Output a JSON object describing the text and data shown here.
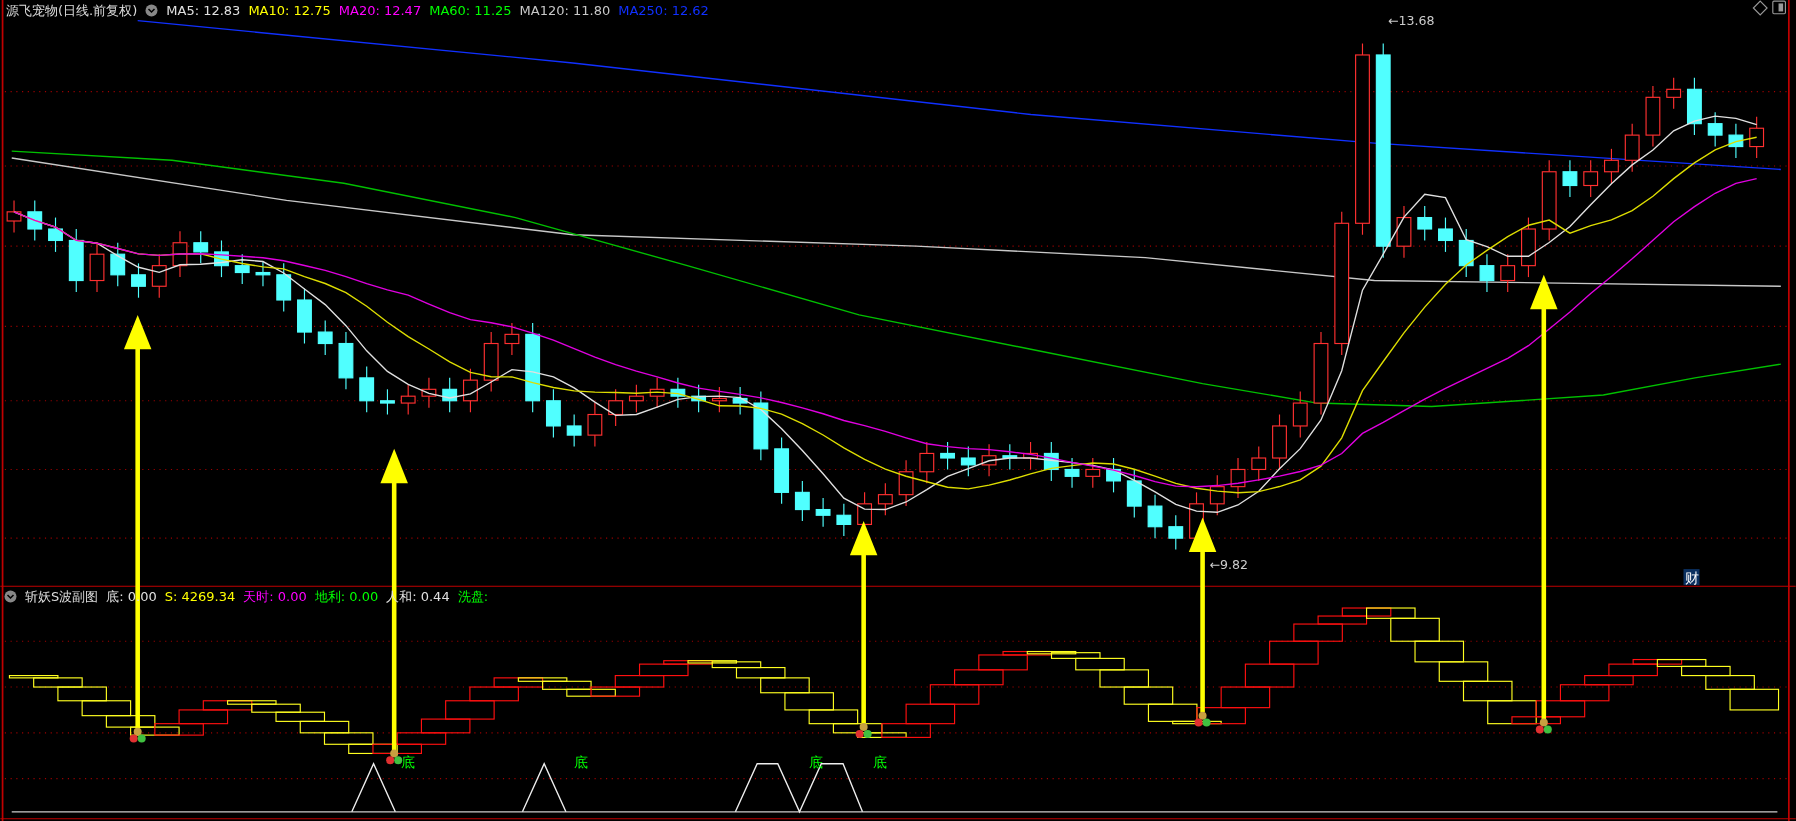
{
  "main_chart": {
    "title": "源飞宠物(日线.前复权)",
    "indicators": [
      {
        "label": "MA5: 12.83",
        "color": "#e0e0e0"
      },
      {
        "label": "MA10: 12.75",
        "color": "#ffff00"
      },
      {
        "label": "MA20: 12.47",
        "color": "#ff00ff"
      },
      {
        "label": "MA60: 11.25",
        "color": "#00ff00"
      },
      {
        "label": "MA120: 11.80",
        "color": "#c8c8c8"
      },
      {
        "label": "MA250: 12.62",
        "color": "#1030ff"
      }
    ],
    "price_labels": [
      {
        "text": "←13.68",
        "kind": "high"
      },
      {
        "text": "←9.82",
        "kind": "low"
      }
    ]
  },
  "sub_chart": {
    "title": "斩妖S波副图",
    "indicators": [
      {
        "label": "底: 0.00",
        "color": "#e0e0e0"
      },
      {
        "label": "S: 4269.34",
        "color": "#ffff00"
      },
      {
        "label": "天时: 0.00",
        "color": "#ff00ff"
      },
      {
        "label": "地利: 0.00",
        "color": "#00ff00"
      },
      {
        "label": "人和: 0.44",
        "color": "#e0e0e0"
      },
      {
        "label": "洗盘:",
        "color": "#00ff00"
      }
    ],
    "markers": [
      {
        "text": "底"
      },
      {
        "text": "底"
      },
      {
        "text": "底"
      },
      {
        "text": "底"
      }
    ]
  },
  "badge": "财"
}
